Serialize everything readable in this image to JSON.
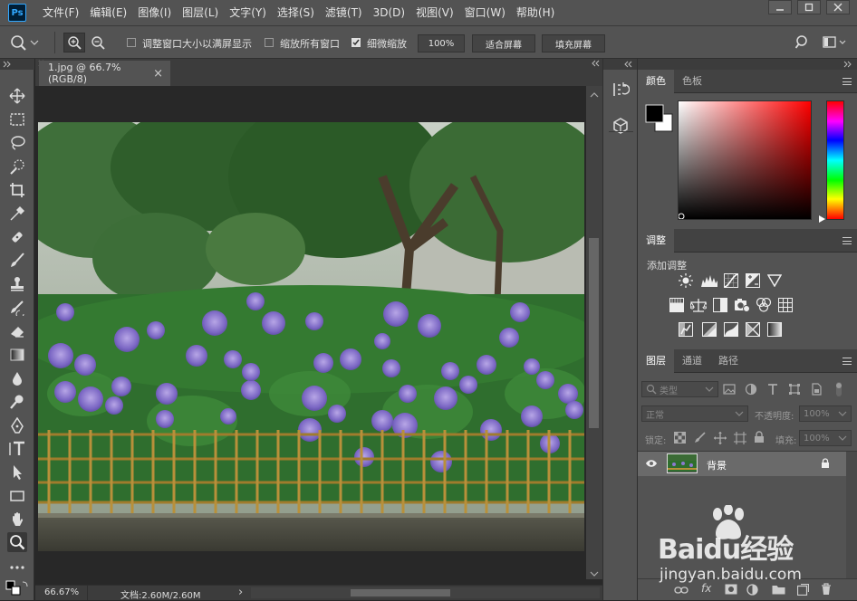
{
  "app": {
    "logo": "Ps"
  },
  "menus": [
    "文件(F)",
    "编辑(E)",
    "图像(I)",
    "图层(L)",
    "文字(Y)",
    "选择(S)",
    "滤镜(T)",
    "3D(D)",
    "视图(V)",
    "窗口(W)",
    "帮助(H)"
  ],
  "options": {
    "resize_windows_label": "调整窗口大小以满屏显示",
    "resize_windows_checked": false,
    "zoom_all_label": "缩放所有窗口",
    "zoom_all_checked": false,
    "scrubby_zoom_label": "细微缩放",
    "scrubby_zoom_checked": true,
    "zoom_value": "100%",
    "fit_screen_label": "适合屏幕",
    "fill_screen_label": "填充屏幕"
  },
  "document": {
    "tab_title": "1.jpg @ 66.7%(RGB/8)",
    "close_glyph": "×"
  },
  "status": {
    "zoom": "66.67%",
    "doc_info": "文档:2.60M/2.60M",
    "arrow": "›"
  },
  "panels": {
    "color_tabs": [
      "颜色",
      "色板"
    ],
    "adjust_tab": "调整",
    "adjust_subtitle": "添加调整",
    "layers_tabs": [
      "图层",
      "通道",
      "路径"
    ],
    "kind_filter": "类型",
    "blend_mode": "正常",
    "opacity_label": "不透明度:",
    "opacity_value": "100%",
    "lock_label": "锁定:",
    "fill_label": "填充:",
    "fill_value": "100%",
    "layer_name": "背景",
    "footer_fx": "fx"
  },
  "watermark": {
    "brand": "Baidu经验",
    "url": "jingyan.baidu.com"
  },
  "colors": {
    "fg": "#000000",
    "bg": "#ffffff",
    "picker_hue": "#ff0000"
  }
}
